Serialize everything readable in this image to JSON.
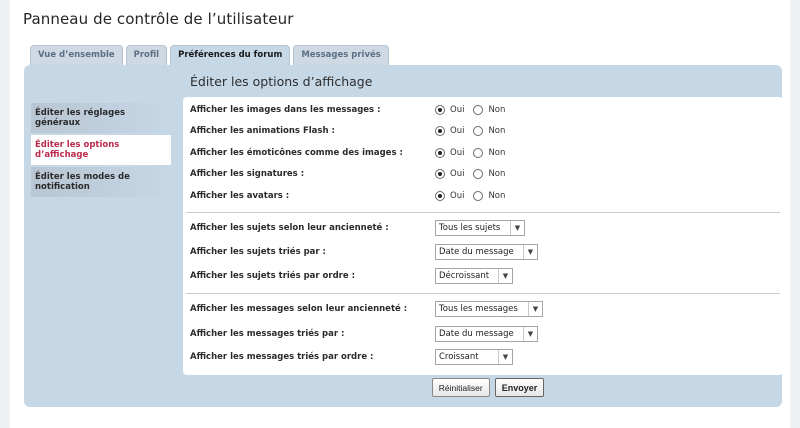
{
  "page": {
    "title": "Panneau de contrôle de l’utilisateur"
  },
  "tabs": [
    {
      "label": "Vue d’ensemble",
      "active": false
    },
    {
      "label": "Profil",
      "active": false
    },
    {
      "label": "Préférences du forum",
      "active": true
    },
    {
      "label": "Messages privés",
      "active": false
    }
  ],
  "panel": {
    "heading": "Éditer les options d’affichage"
  },
  "side_menu": [
    {
      "label": "Éditer les réglages généraux",
      "active": false
    },
    {
      "label": "Éditer les options d’affichage",
      "active": true
    },
    {
      "label": "Éditer les modes de notification",
      "active": false
    }
  ],
  "radio_options": {
    "yes": "Oui",
    "no": "Non"
  },
  "radio_rows": [
    {
      "label": "Afficher les images dans les messages :",
      "selected": "yes"
    },
    {
      "label": "Afficher les animations Flash :",
      "selected": "yes"
    },
    {
      "label": "Afficher les émoticônes comme des images :",
      "selected": "yes"
    },
    {
      "label": "Afficher les signatures :",
      "selected": "yes"
    },
    {
      "label": "Afficher les avatars :",
      "selected": "yes"
    }
  ],
  "topic_rows": [
    {
      "label": "Afficher les sujets selon leur ancienneté :",
      "value": "Tous les sujets"
    },
    {
      "label": "Afficher les sujets triés par :",
      "value": "Date du message"
    },
    {
      "label": "Afficher les sujets triés par ordre :",
      "value": "Décroissant"
    }
  ],
  "post_rows": [
    {
      "label": "Afficher les messages selon leur ancienneté :",
      "value": "Tous les messages"
    },
    {
      "label": "Afficher les messages triés par :",
      "value": "Date du message"
    },
    {
      "label": "Afficher les messages triés par ordre :",
      "value": "Croissant"
    }
  ],
  "buttons": {
    "reset": "Réinitialiser",
    "submit": "Envoyer"
  }
}
